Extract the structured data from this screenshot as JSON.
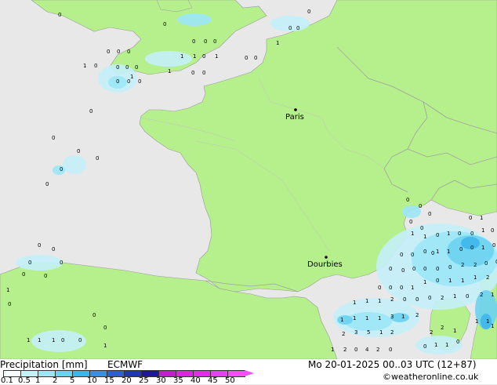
{
  "map": {
    "cities": [
      {
        "name": "Paris"
      },
      {
        "name": "Dourbies"
      }
    ],
    "value_labels": [
      "0",
      "0",
      "0",
      "0",
      "0",
      "0",
      "0",
      "0",
      "1",
      "0",
      "0",
      "0",
      "0",
      "0",
      "1",
      "1",
      "0",
      "1",
      "1",
      "0",
      "0",
      "0",
      "0",
      "1",
      "0",
      "0",
      "0",
      "0",
      "0",
      "1",
      "0",
      "0",
      "0",
      "0",
      "0",
      "0",
      "0",
      "0",
      "0",
      "0",
      "0",
      "0",
      "1",
      "0",
      "0",
      "0",
      "1",
      "1",
      "1",
      "0",
      "0",
      "1",
      "0",
      "0",
      "0",
      "0",
      "0",
      "0",
      "1",
      "1",
      "1",
      "0",
      "1",
      "0",
      "0",
      "1",
      "0",
      "0",
      "0",
      "0",
      "0",
      "1",
      "1",
      "0",
      "0",
      "1",
      "0",
      "0",
      "0",
      "0",
      "0",
      "0",
      "0",
      "2",
      "2",
      "0",
      "0",
      "0",
      "0",
      "0",
      "1",
      "1",
      "0",
      "1",
      "1",
      "1",
      "2",
      "1",
      "1",
      "1",
      "2",
      "0",
      "0",
      "0",
      "2",
      "1",
      "0",
      "2",
      "1",
      "1",
      "1",
      "1",
      "1",
      "3",
      "1",
      "2",
      "2",
      "3",
      "5",
      "1",
      "2",
      "2",
      "2",
      "1",
      "1",
      "1",
      "0",
      "1",
      "1",
      "0",
      "1",
      "2",
      "0",
      "4",
      "2",
      "0",
      "1",
      "1",
      "12",
      "2",
      "1",
      "0",
      "0",
      "1",
      "1",
      "0",
      "2",
      "2",
      "1",
      "0",
      "3",
      "1",
      "4",
      "12"
    ]
  },
  "legend": {
    "title": "Precipitation [mm]",
    "model": "ECMWF",
    "ticks": [
      "0.1",
      "0.5",
      "1",
      "2",
      "5",
      "10",
      "15",
      "20",
      "25",
      "30",
      "35",
      "40",
      "45",
      "50"
    ],
    "colors": [
      "#f5fcfe",
      "#c4f0f8",
      "#9be5f6",
      "#6bd2f0",
      "#3fb6ea",
      "#3c8ede",
      "#2e60cc",
      "#1f36b8",
      "#1c1896",
      "#c020c8",
      "#d62adc",
      "#e030e6",
      "#ea40ee",
      "#f050f4"
    ]
  },
  "timestamp": "Mo 20-01-2025 00..03 UTC (12+87)",
  "credit": "©weatheronline.co.uk"
}
